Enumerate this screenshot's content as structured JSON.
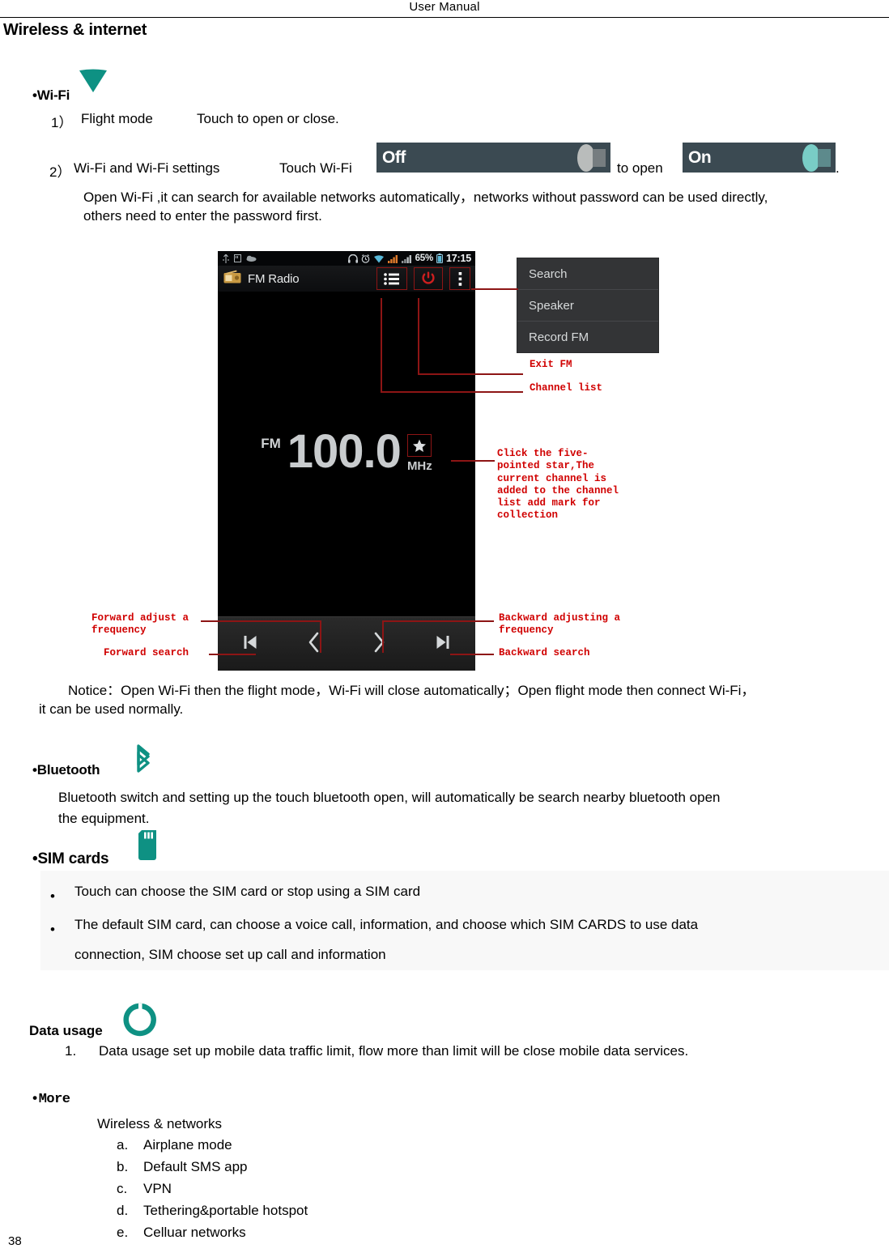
{
  "header": {
    "title": "User    Manual"
  },
  "page": {
    "number": "38",
    "section_title": "Wireless & internet"
  },
  "wifi": {
    "heading": "•Wi-Fi",
    "icon": "wifi-fan-icon",
    "item1_num": "1）",
    "item1_label": "Flight mode",
    "item1_desc": "Touch to open or close.",
    "item2_num": "2）",
    "item2_label": "Wi-Fi and Wi-Fi settings",
    "item2_pre": "Touch Wi-Fi",
    "item2_mid": "to open",
    "item2_end": ".",
    "toggle_off_label": "Off",
    "toggle_on_label": "On",
    "paragraph_line1": "Open Wi-Fi ,it can search for available networks automatically，networks without password can be used directly,",
    "paragraph_line2": "others need to enter the password first.",
    "notice_line1": "Notice：Open Wi-Fi then the flight mode，Wi-Fi will close automatically；Open flight mode then connect Wi-Fi，",
    "notice_line2": "it can be used normally."
  },
  "screenshot": {
    "statusbar": {
      "left_icons": [
        "usb-icon",
        "sd-card-icon",
        "cloud-icon"
      ],
      "right_icons": [
        "headset-icon",
        "alarm-icon",
        "wifi-signal-icon",
        "cellular-signal-1-icon",
        "cellular-signal-2-icon"
      ],
      "battery_percent": "65%",
      "battery_icon": "battery-icon",
      "clock": "17:15"
    },
    "appbar": {
      "app_icon": "fm-radio-app-icon",
      "title": "FM Radio",
      "actions": [
        "channel-list-icon",
        "power-icon",
        "overflow-menu-icon"
      ]
    },
    "display": {
      "band": "FM",
      "frequency": "100.0",
      "unit": "MHz",
      "favorite_icon": "star-icon"
    },
    "controls": [
      "skip-previous-icon",
      "chevron-left-icon",
      "chevron-right-icon",
      "skip-next-icon"
    ],
    "popup_menu": [
      "Search",
      "Speaker",
      "Record FM"
    ],
    "callouts": {
      "exit_fm": "Exit FM",
      "channel_list": "Channel list",
      "star": "Click the five-\npointed star,The\ncurrent channel is\nadded to the channel\nlist add mark for\ncollection",
      "forward_adjust": "Forward adjust a\nfrequency",
      "forward_search": "Forward search",
      "backward_adjust": "Backward adjusting a\nfrequency",
      "backward_search": "Backward search"
    }
  },
  "bluetooth": {
    "heading": "•Bluetooth",
    "icon": "bluetooth-icon",
    "line1": "Bluetooth switch and setting up the touch bluetooth open, will automatically be search nearby bluetooth open",
    "line2": "the equipment."
  },
  "sim_cards": {
    "heading": "•SIM cards",
    "icon": "sim-card-icon",
    "bullet1": "Touch can choose the SIM card or stop using a SIM card",
    "bullet2_line1": "The default SIM card, can choose a voice call, information, and choose which SIM CARDS to use data",
    "bullet2_line2": "connection, SIM choose set up call and information"
  },
  "data_usage": {
    "heading": "Data usage",
    "icon": "data-usage-ring-icon",
    "item_num": "1.",
    "item_text": "Data usage    set up mobile data traffic limit, flow more than limit will be close mobile data services."
  },
  "more": {
    "heading": "•More",
    "subheading": "Wireless & networks",
    "items": [
      {
        "marker": "a.",
        "label": "Airplane mode"
      },
      {
        "marker": "b.",
        "label": "Default SMS app"
      },
      {
        "marker": "c.",
        "label": "VPN"
      },
      {
        "marker": "d.",
        "label": "Tethering&portable hotspot"
      },
      {
        "marker": "e.",
        "label": "Celluar networks"
      }
    ]
  },
  "colors": {
    "teal": "#0e9183",
    "annotation_red": "#d00000",
    "toggle_bg": "#3b4a52",
    "menu_bg": "#333436"
  }
}
